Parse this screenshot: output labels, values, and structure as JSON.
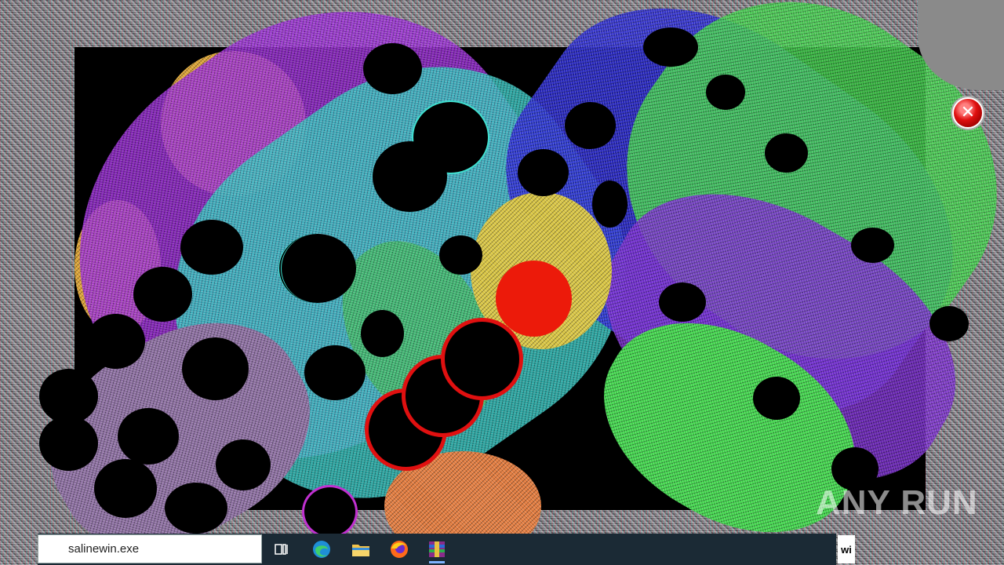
{
  "taskbar": {
    "search_value": "salinewin.exe",
    "pinned_apps": [
      {
        "name": "Task View",
        "icon": "task-view-icon"
      },
      {
        "name": "Microsoft Edge",
        "icon": "edge-icon"
      },
      {
        "name": "File Explorer",
        "icon": "folder-icon"
      },
      {
        "name": "Firefox",
        "icon": "firefox-icon"
      },
      {
        "name": "WinRAR",
        "icon": "winrar-icon"
      }
    ],
    "tray_text": "wi"
  },
  "overlay": {
    "close_glyph": "✕",
    "watermark": "ANY RUN"
  },
  "colors": {
    "noise_gray": "#8a8a8a",
    "purple": "#9a2bd6",
    "cyan": "#2fc9c0",
    "green": "#3ed64a",
    "blue": "#2a2ad0",
    "orange": "#e6a23a",
    "red": "#e81a0a",
    "taskbar": "#1b2a35"
  }
}
